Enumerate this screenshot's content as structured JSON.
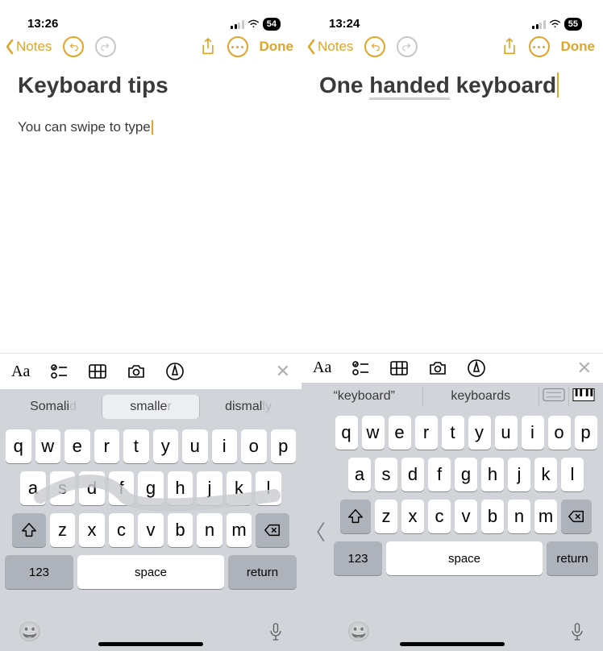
{
  "left": {
    "status": {
      "time": "13:26",
      "battery": "54"
    },
    "nav": {
      "back": "Notes",
      "done": "Done"
    },
    "content": {
      "title": "Keyboard tips",
      "body": "You can swipe to type"
    },
    "format_icons": [
      "Aa",
      "checklist",
      "table",
      "camera",
      "markup",
      "close"
    ],
    "suggestions": [
      {
        "text": "Somali",
        "fade": "d",
        "sel": false
      },
      {
        "text": "smalle",
        "fade": "r",
        "sel": true
      },
      {
        "text": "dismal",
        "fade": "ly",
        "sel": false
      }
    ],
    "rows": {
      "r1": [
        "q",
        "w",
        "e",
        "r",
        "t",
        "y",
        "u",
        "i",
        "o",
        "p"
      ],
      "r2": [
        "a",
        "s",
        "d",
        "f",
        "g",
        "h",
        "j",
        "k",
        "l"
      ],
      "r3": [
        "z",
        "x",
        "c",
        "v",
        "b",
        "n",
        "m"
      ]
    },
    "bottom": {
      "nums": "123",
      "space": "space",
      "ret": "return"
    }
  },
  "right": {
    "status": {
      "time": "13:24",
      "battery": "55"
    },
    "nav": {
      "back": "Notes",
      "done": "Done"
    },
    "content": {
      "title_a": "One ",
      "title_b": "handed",
      "title_c": " keyboard"
    },
    "format_icons": [
      "Aa",
      "checklist",
      "table",
      "camera",
      "markup",
      "close"
    ],
    "suggestions": [
      {
        "text": "“keyboard”"
      },
      {
        "text": "keyboards"
      }
    ],
    "rows": {
      "r1": [
        "q",
        "w",
        "e",
        "r",
        "t",
        "y",
        "u",
        "i",
        "o",
        "p"
      ],
      "r2": [
        "a",
        "s",
        "d",
        "f",
        "g",
        "h",
        "j",
        "k",
        "l"
      ],
      "r3": [
        "z",
        "x",
        "c",
        "v",
        "b",
        "n",
        "m"
      ]
    },
    "bottom": {
      "nums": "123",
      "space": "space",
      "ret": "return"
    }
  }
}
